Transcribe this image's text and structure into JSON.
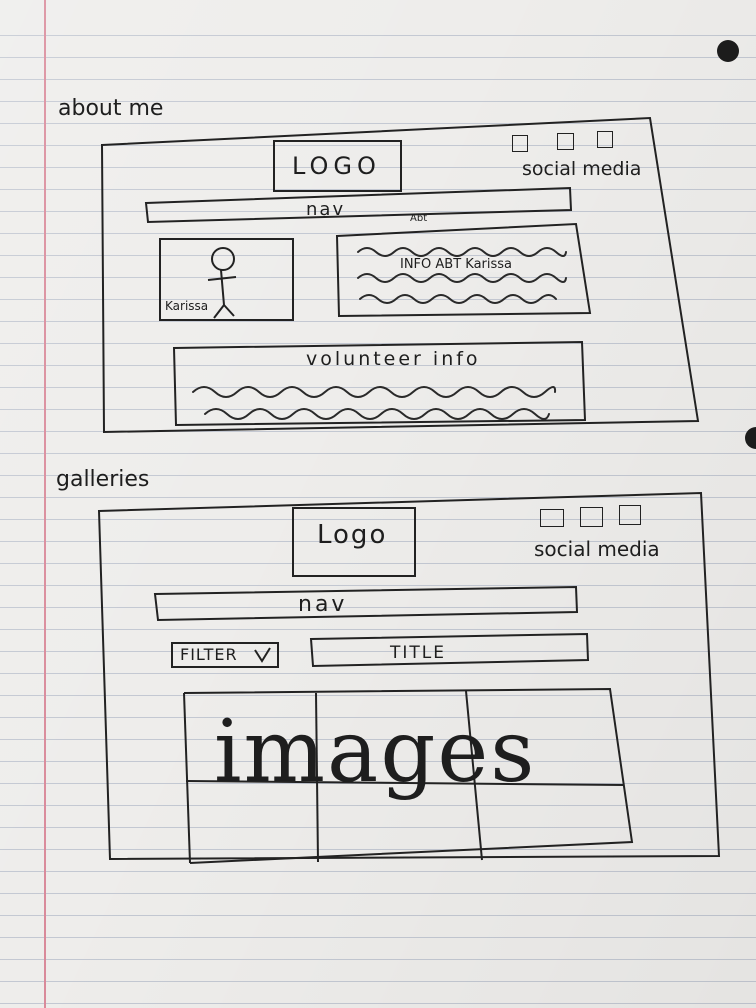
{
  "sections": {
    "about": {
      "heading": "about me",
      "logo": "LOGO",
      "social_label": "social media",
      "nav": "nav",
      "abt_note": "Abt",
      "person_label": "Karissa",
      "info_label": "INFO ABT Karissa",
      "volunteer_label": "volunteer info"
    },
    "galleries": {
      "heading": "galleries",
      "logo": "Logo",
      "social_label": "social media",
      "nav": "nav",
      "filter_label": "FILTER",
      "title_label": "TITLE",
      "images_label": "images"
    }
  },
  "colors": {
    "ink": "#222222",
    "margin_line": "#d98a9a",
    "ruled_line": "#c3c8d2",
    "paper": "#eeedeb"
  }
}
